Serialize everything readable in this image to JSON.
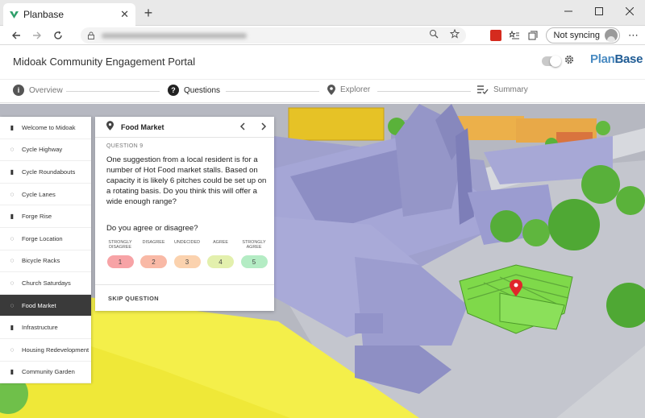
{
  "browser": {
    "tab_title": "Planbase",
    "tab_close": "✕",
    "new_tab": "+",
    "sync_label": "Not syncing"
  },
  "app": {
    "title": "Midoak Community Engagement Portal",
    "logo_plan": "Plan",
    "logo_base": "Base"
  },
  "steps": [
    {
      "label": "Overview",
      "icon": "info-icon"
    },
    {
      "label": "Questions",
      "icon": "question-icon"
    },
    {
      "label": "Explorer",
      "icon": "map-pin-icon"
    },
    {
      "label": "Summary",
      "icon": "list-check-icon"
    }
  ],
  "sidebar": {
    "items": [
      {
        "label": "Welcome to Midoak",
        "icon": "bookmark-icon"
      },
      {
        "label": "Cycle Highway",
        "icon": "comment-icon"
      },
      {
        "label": "Cycle Roundabouts",
        "icon": "bookmark-icon"
      },
      {
        "label": "Cycle Lanes",
        "icon": "comment-icon"
      },
      {
        "label": "Forge Rise",
        "icon": "bookmark-icon"
      },
      {
        "label": "Forge Location",
        "icon": "comment-icon"
      },
      {
        "label": "Bicycle Racks",
        "icon": "comment-icon"
      },
      {
        "label": "Church Saturdays",
        "icon": "comment-icon"
      },
      {
        "label": "Food Market",
        "icon": "comment-icon",
        "active": true
      },
      {
        "label": "Infrastructure",
        "icon": "bookmark-icon"
      },
      {
        "label": "Housing Redevelopment",
        "icon": "comment-icon"
      },
      {
        "label": "Community Garden",
        "icon": "bookmark-icon"
      }
    ]
  },
  "card": {
    "title": "Food Market",
    "question_number": "QUESTION 9",
    "question_text": "One suggestion from a local resident is for a number of Hot Food market stalls. Based on capacity it is likely 6 pitches could be set up on a rotating basis. Do you think this will offer a wide enough range?",
    "prompt": "Do you agree or disagree?",
    "options": [
      {
        "label": "STRONGLY DISAGREE",
        "value": "1",
        "color": "#f7a3a6"
      },
      {
        "label": "DISAGREE",
        "value": "2",
        "color": "#f9b9a6"
      },
      {
        "label": "UNDECIDED",
        "value": "3",
        "color": "#fbd2ae"
      },
      {
        "label": "AGREE",
        "value": "4",
        "color": "#e3f0ad"
      },
      {
        "label": "STRONGLY AGREE",
        "value": "5",
        "color": "#b4ecc4"
      }
    ],
    "skip_label": "SKIP QUESTION"
  }
}
